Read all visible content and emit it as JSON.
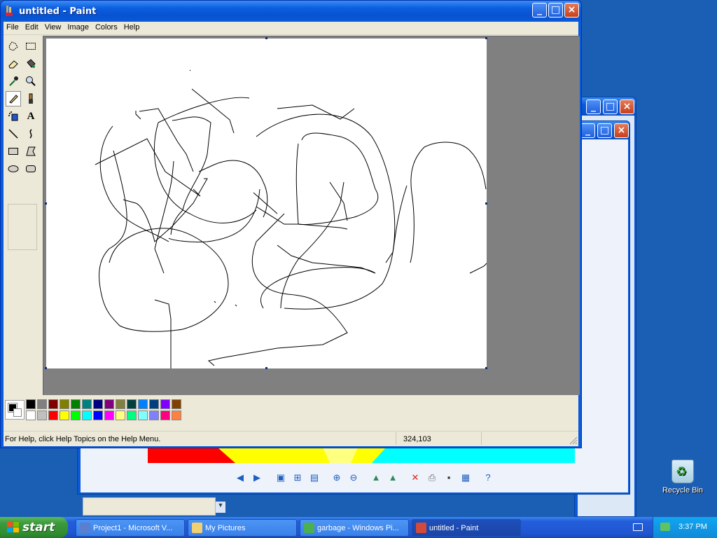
{
  "paint": {
    "title": "untitled - Paint",
    "menu": [
      "File",
      "Edit",
      "View",
      "Image",
      "Colors",
      "Help"
    ],
    "status_help": "For Help, click Help Topics on the Help Menu.",
    "status_coords": "324,103",
    "palette_top": [
      "#000000",
      "#808080",
      "#800000",
      "#808000",
      "#008000",
      "#008080",
      "#000080",
      "#800080",
      "#808040",
      "#004040",
      "#0080ff",
      "#004080",
      "#8000ff",
      "#804000"
    ],
    "palette_bottom": [
      "#ffffff",
      "#c0c0c0",
      "#ff0000",
      "#ffff00",
      "#00ff00",
      "#00ffff",
      "#0000ff",
      "#ff00ff",
      "#ffff80",
      "#00ff80",
      "#80ffff",
      "#8080ff",
      "#ff0080",
      "#ff8040"
    ],
    "tools": [
      "free-select",
      "rect-select",
      "eraser",
      "fill",
      "color-picker",
      "magnifier",
      "pencil",
      "brush",
      "airbrush",
      "text",
      "line",
      "curve",
      "rectangle",
      "polygon",
      "ellipse",
      "rounded-rectangle"
    ],
    "active_tool": "pencil"
  },
  "taskbar": {
    "start_label": "start",
    "tasks": [
      {
        "label": "Project1 - Microsoft V...",
        "icon": "visual-basic-icon"
      },
      {
        "label": "My Pictures",
        "icon": "folder-icon"
      },
      {
        "label": "garbage - Windows Pi...",
        "icon": "picture-viewer-icon"
      },
      {
        "label": "untitled - Paint",
        "icon": "paint-icon",
        "active": true
      }
    ],
    "clock": "3:37 PM"
  },
  "desktop": {
    "recycle_bin_label": "Recycle Bin"
  }
}
